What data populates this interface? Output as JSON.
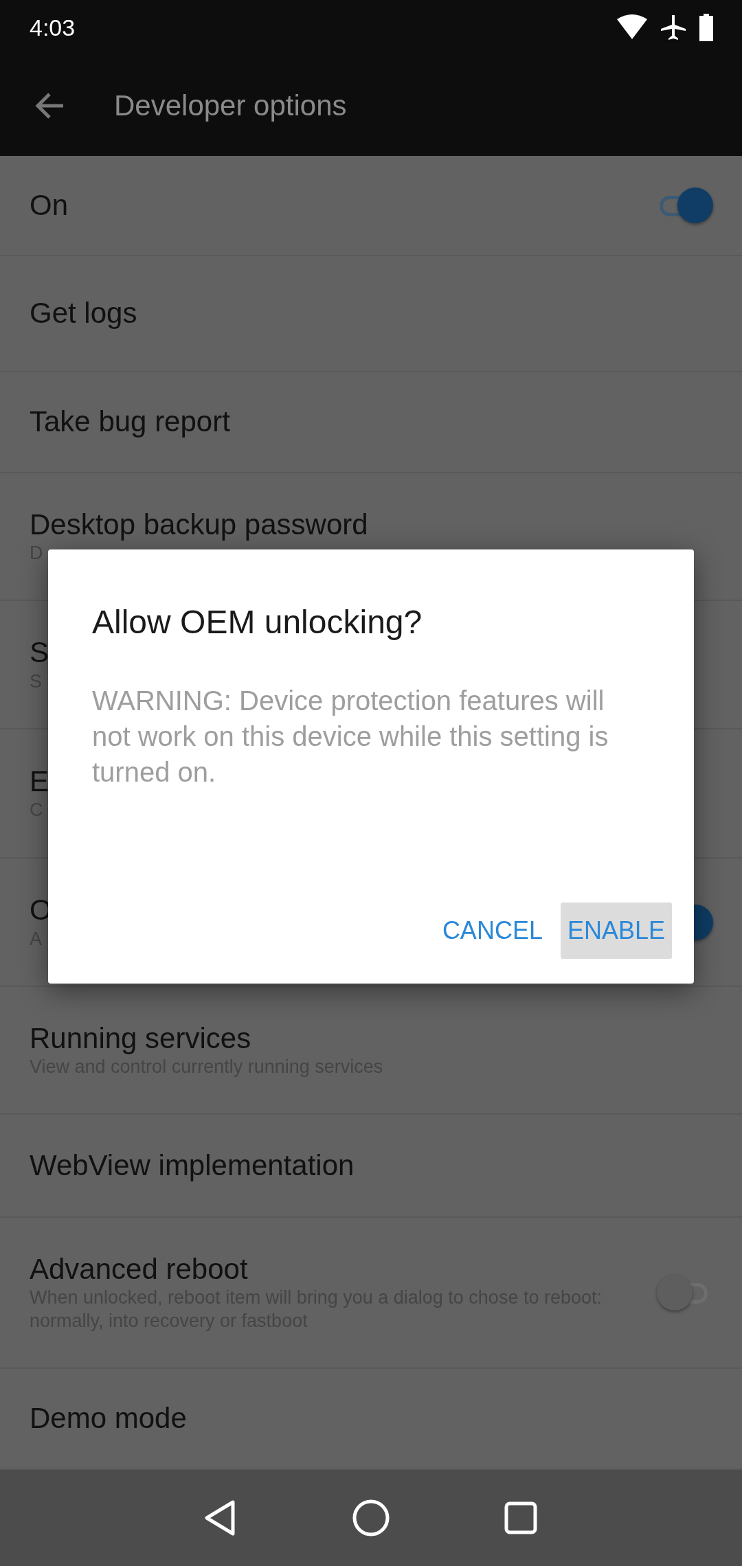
{
  "status_bar": {
    "time": "4:03"
  },
  "app_bar": {
    "title": "Developer options"
  },
  "items": [
    {
      "kind": "switch",
      "title": "On",
      "on": true
    },
    {
      "kind": "text",
      "title": "Get logs"
    },
    {
      "kind": "text",
      "title": "Take bug report"
    },
    {
      "kind": "text",
      "title": "Desktop backup password",
      "subtitle": "D"
    },
    {
      "kind": "text",
      "title": "S",
      "subtitle": "S"
    },
    {
      "kind": "text",
      "title": "E",
      "subtitle": "C"
    },
    {
      "kind": "switch",
      "title": "O",
      "subtitle": "A",
      "on": true
    },
    {
      "kind": "text",
      "title": "Running services",
      "subtitle": "View and control currently running services"
    },
    {
      "kind": "text",
      "title": "WebView implementation"
    },
    {
      "kind": "switch",
      "title": "Advanced reboot",
      "subtitle": "When unlocked, reboot item will bring you a dialog to chose to reboot: normally, into recovery or fastboot",
      "on": false
    },
    {
      "kind": "text",
      "title": "Demo mode"
    }
  ],
  "dialog": {
    "title": "Allow OEM unlocking?",
    "message": "WARNING: Device protection features will not work on this device while this setting is turned on.",
    "buttons": [
      {
        "label": "CANCEL",
        "selected": false
      },
      {
        "label": "ENABLE",
        "selected": true
      }
    ]
  }
}
